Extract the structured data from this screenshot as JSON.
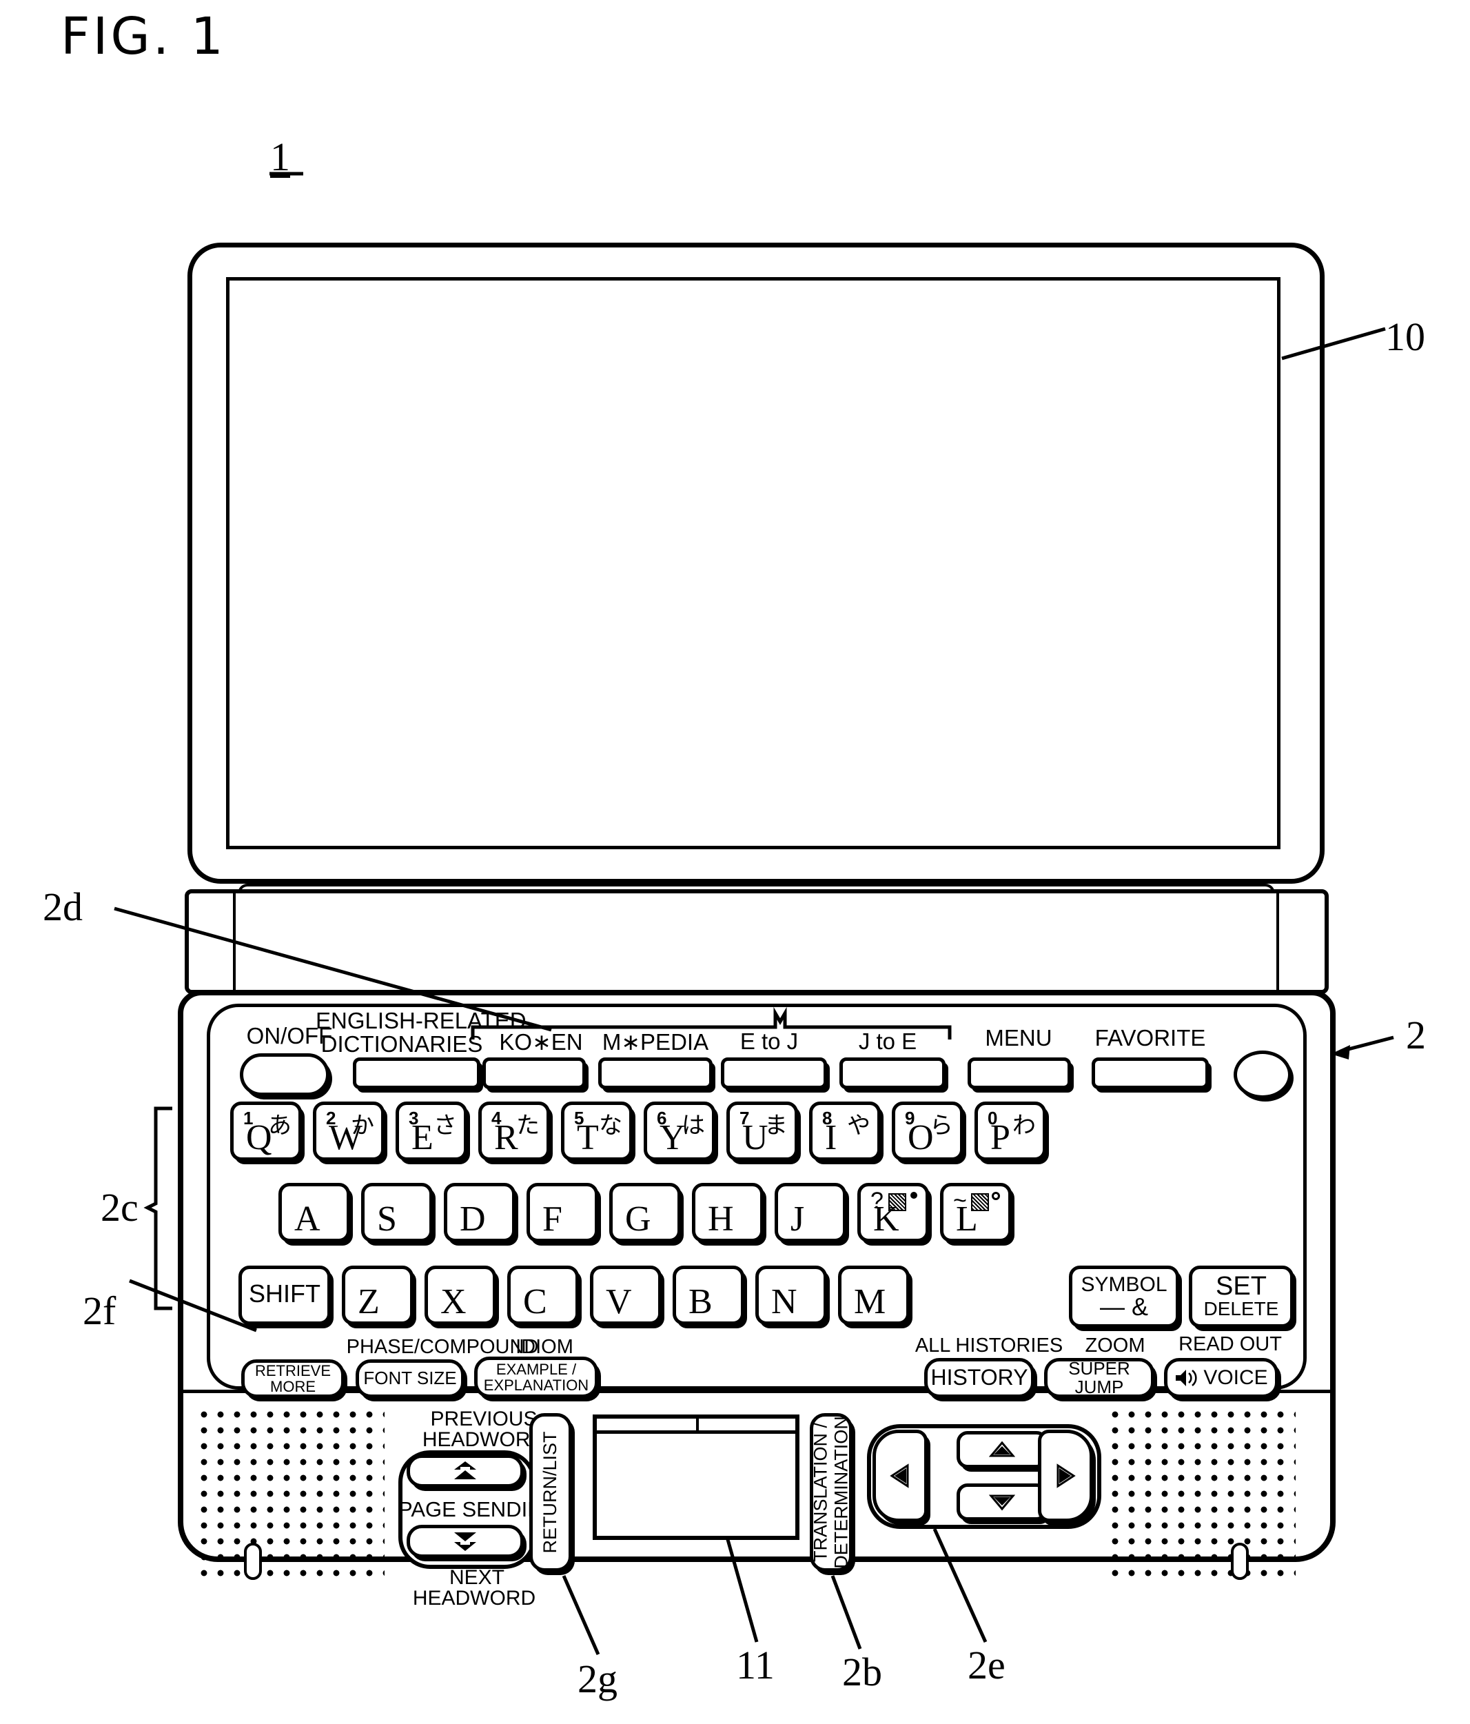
{
  "figure": {
    "title": "FIG. 1",
    "ref_device": "1",
    "ref_lid": "10",
    "ref_base": "2",
    "ref_dict_keys": "2d",
    "ref_char_keys": "2c",
    "ref_shift_key": "2f",
    "ref_return_key": "2g",
    "ref_touchpad": "11",
    "ref_translation_key": "2b",
    "ref_cursor_keys": "2e"
  },
  "function_row": {
    "power_caption": "ON/OFF",
    "dictionaries_caption_line1": "ENGLISH-RELATED",
    "dictionaries_caption_line2": "DICTIONARIES",
    "keys": [
      {
        "caption": "KO∗EN"
      },
      {
        "caption": "M∗PEDIA"
      },
      {
        "caption": "E to J"
      },
      {
        "caption": "J to E"
      },
      {
        "caption": "MENU"
      },
      {
        "caption": "FAVORITE"
      }
    ]
  },
  "keyboard": {
    "row1": [
      {
        "letter": "Q",
        "number": "1",
        "kana": "あ"
      },
      {
        "letter": "W",
        "number": "2",
        "kana": "か"
      },
      {
        "letter": "E",
        "number": "3",
        "kana": "さ"
      },
      {
        "letter": "R",
        "number": "4",
        "kana": "た"
      },
      {
        "letter": "T",
        "number": "5",
        "kana": "な"
      },
      {
        "letter": "Y",
        "number": "6",
        "kana": "は"
      },
      {
        "letter": "U",
        "number": "7",
        "kana": "ま"
      },
      {
        "letter": "I",
        "number": "8",
        "kana": "や"
      },
      {
        "letter": "O",
        "number": "9",
        "kana": "ら"
      },
      {
        "letter": "P",
        "number": "0",
        "kana": "わ"
      }
    ],
    "row2": [
      {
        "letter": "A"
      },
      {
        "letter": "S"
      },
      {
        "letter": "D"
      },
      {
        "letter": "F"
      },
      {
        "letter": "G"
      },
      {
        "letter": "H"
      },
      {
        "letter": "J"
      },
      {
        "letter": "K",
        "punct": "?",
        "mark": "dakuten"
      },
      {
        "letter": "L",
        "punct": "~",
        "mark": "handakuten"
      }
    ],
    "row3": [
      {
        "letter": "SHIFT",
        "wide": true
      },
      {
        "letter": "Z"
      },
      {
        "letter": "X"
      },
      {
        "letter": "C"
      },
      {
        "letter": "V"
      },
      {
        "letter": "B"
      },
      {
        "letter": "N"
      },
      {
        "letter": "M"
      }
    ],
    "symbol_key": {
      "line1": "SYMBOL",
      "line2": "—   &"
    },
    "set_delete_key": {
      "line1": "SET",
      "line2": "DELETE"
    }
  },
  "shortcut_row": {
    "captions": {
      "phase_compound": "PHASE/COMPOUND",
      "idiom": "IDIOM",
      "all_histories": "ALL HISTORIES",
      "zoom": "ZOOM",
      "read_out": "READ OUT"
    },
    "keys": {
      "retrieve_more_line1": "RETRIEVE",
      "retrieve_more_line2": "MORE",
      "font_size": "FONT SIZE",
      "example_line1": "EXAMPLE /",
      "example_line2": "EXPLANATION",
      "history": "HISTORY",
      "super_jump": "SUPER JUMP",
      "voice": "VOICE"
    }
  },
  "control_panel": {
    "previous_headword_line1": "PREVIOUS",
    "previous_headword_line2": "HEADWORD",
    "page_sending": "PAGE SENDING",
    "next_headword_line1": "NEXT",
    "next_headword_line2": "HEADWORD",
    "return_list": "RETURN/LIST",
    "translation_line1": "TRANSLATION /",
    "translation_line2": "DETERMINATION"
  },
  "colors": {
    "ink": "#000000",
    "paper": "#ffffff"
  }
}
